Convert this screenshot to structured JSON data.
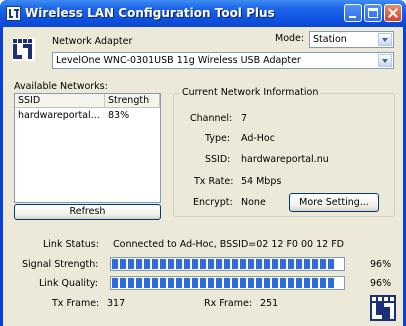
{
  "window": {
    "title": "Wireless LAN Configuration Tool Plus"
  },
  "adapter": {
    "label": "Network Adapter",
    "mode_label": "Mode:",
    "mode_value": "Station",
    "adapter_value": "LevelOne WNC-0301USB 11g Wireless USB Adapter"
  },
  "networks": {
    "label": "Available Networks:",
    "columns": [
      "SSID",
      "Strength"
    ],
    "rows": [
      {
        "ssid": "hardwareportal...",
        "strength": "83%"
      }
    ],
    "refresh_label": "Refresh"
  },
  "info": {
    "legend": "Current Network Information",
    "channel_label": "Channel:",
    "channel_value": "7",
    "type_label": "Type:",
    "type_value": "Ad-Hoc",
    "ssid_label": "SSID:",
    "ssid_value": "hardwareportal.nu",
    "txrate_label": "Tx Rate:",
    "txrate_value": "54 Mbps",
    "encrypt_label": "Encrypt:",
    "encrypt_value": "None",
    "more_label": "More Setting..."
  },
  "status": {
    "link_label": "Link Status:",
    "link_value": "Connected to Ad-Hoc, BSSID=02 12 F0 00 12 FD",
    "signal_label": "Signal Strength:",
    "signal_value": "96%",
    "signal_fraction": 0.96,
    "quality_label": "Link Quality:",
    "quality_value": "96%",
    "quality_fraction": 0.96,
    "tx_label": "Tx Frame:",
    "tx_value": "317",
    "rx_label": "Rx Frame:",
    "rx_value": "251"
  },
  "colors": {
    "titlebar": "#0f52e0",
    "bar_fill": "#2f6adf",
    "logo": "#1d2f77"
  },
  "icons": {
    "app": "levelone-logo-icon",
    "minimize": "minimize-icon",
    "maximize": "maximize-icon",
    "close": "close-icon"
  }
}
